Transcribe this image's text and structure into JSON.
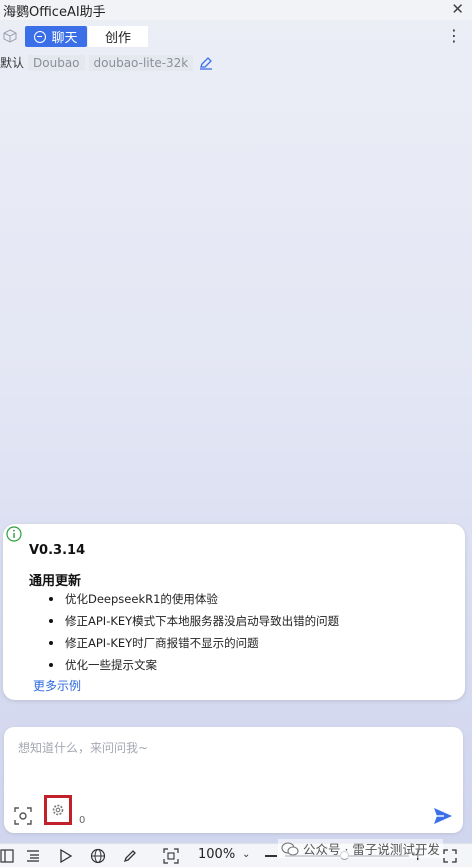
{
  "window": {
    "title": "海鹦OfficeAI助手",
    "close_label": "✕"
  },
  "tabs": [
    {
      "label": "聊天",
      "active": true
    },
    {
      "label": "创作",
      "active": false
    }
  ],
  "model": {
    "default_label": "默认",
    "provider": "Doubao",
    "name": "doubao-lite-32k"
  },
  "update_card": {
    "version": "V0.3.14",
    "section_title": "通用更新",
    "notes": [
      "优化DeepseekR1的使用体验",
      "修正API-KEY模式下本地服务器没启动导致出错的问题",
      "修正API-KEY时厂商报错不显示的问题",
      "优化一些提示文案"
    ],
    "more_link": "更多示例"
  },
  "input": {
    "placeholder": "想知道什么，来问问我~",
    "value": "",
    "char_count": "0"
  },
  "toolbar": {
    "zoom": "100%",
    "zoom_level_percent": 100
  },
  "watermark": "公众号 · 雷子说测试开发",
  "colors": {
    "accent": "#3a6fe8",
    "highlight_box": "#c0212a",
    "info_green": "#2e9e3e",
    "link": "#2f6ae0"
  }
}
